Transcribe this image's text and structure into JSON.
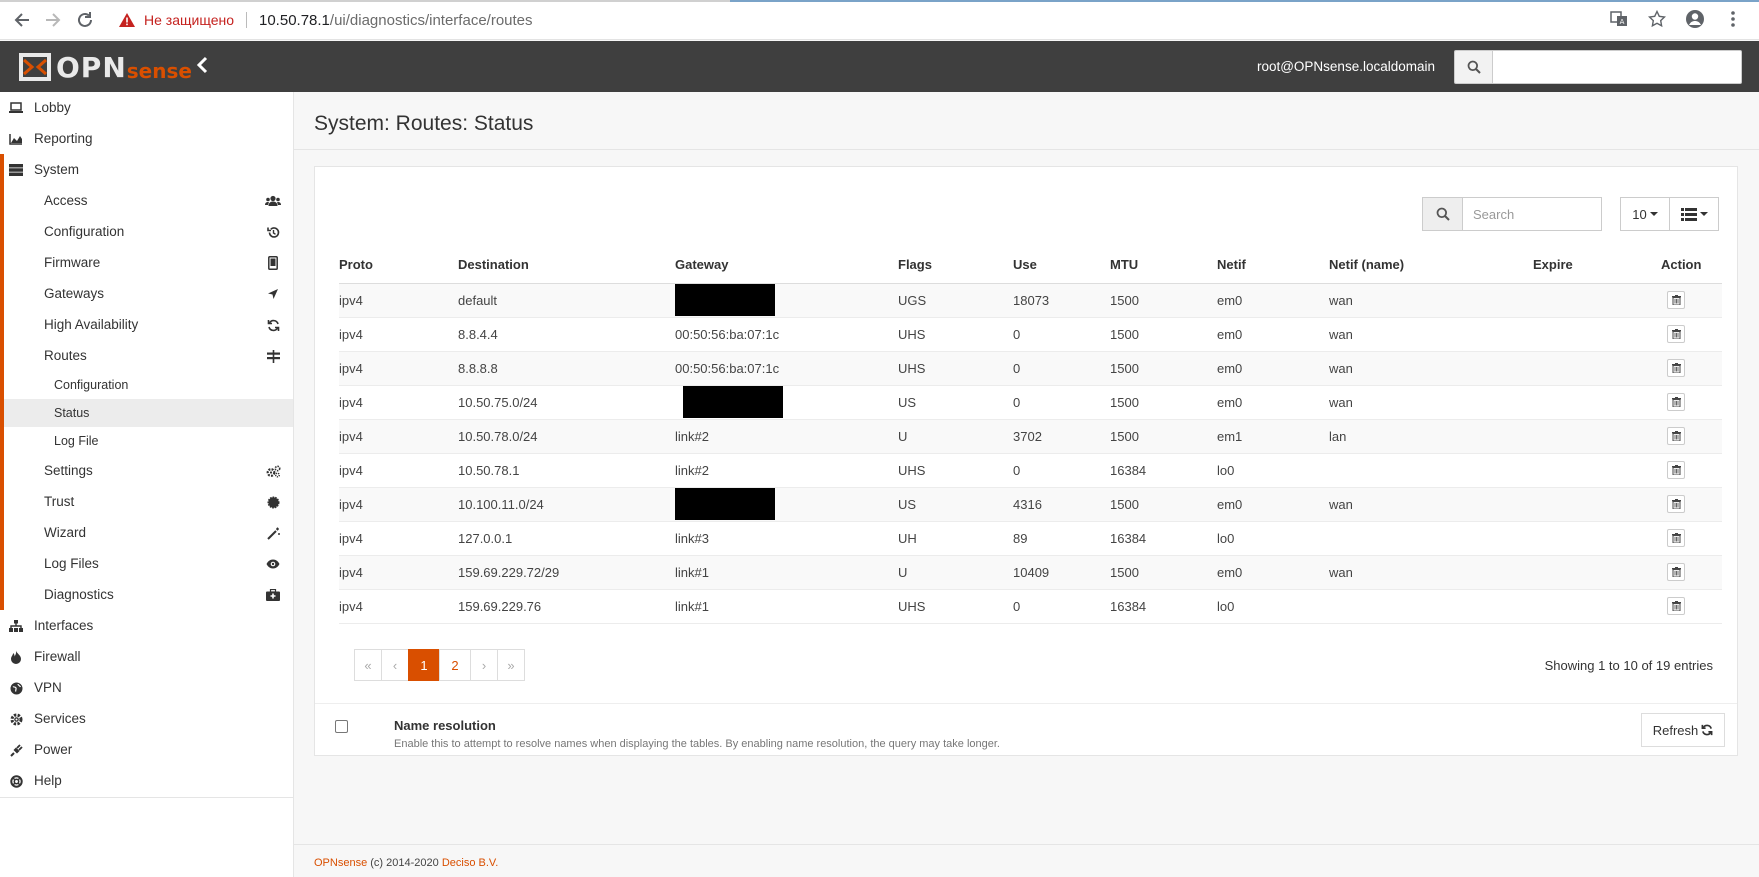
{
  "browser": {
    "not_secure": "Не защищено",
    "url_host": "10.50.78.1",
    "url_path": "/ui/diagnostics/interface/routes"
  },
  "topnav": {
    "logo_text": "OPN",
    "logo_sense": "sense",
    "user": "root@OPNsense.localdomain"
  },
  "sidebar": {
    "lobby": "Lobby",
    "reporting": "Reporting",
    "system": "System",
    "system_items": [
      {
        "label": "Access",
        "icon": "users-icon"
      },
      {
        "label": "Configuration",
        "icon": "history-icon"
      },
      {
        "label": "Firmware",
        "icon": "tablet-icon"
      },
      {
        "label": "Gateways",
        "icon": "location-arrow-icon"
      },
      {
        "label": "High Availability",
        "icon": "refresh-icon"
      },
      {
        "label": "Routes",
        "icon": "signpost-icon"
      }
    ],
    "routes_sub": [
      "Configuration",
      "Status",
      "Log File"
    ],
    "system_items_after": [
      {
        "label": "Settings",
        "icon": "cogs-icon"
      },
      {
        "label": "Trust",
        "icon": "certificate-icon"
      },
      {
        "label": "Wizard",
        "icon": "magic-icon"
      },
      {
        "label": "Log Files",
        "icon": "eye-icon"
      },
      {
        "label": "Diagnostics",
        "icon": "medkit-icon"
      }
    ],
    "bottom_items": [
      {
        "label": "Interfaces",
        "icon": "sitemap-icon"
      },
      {
        "label": "Firewall",
        "icon": "fire-icon"
      },
      {
        "label": "VPN",
        "icon": "globe-icon"
      },
      {
        "label": "Services",
        "icon": "cog-icon"
      },
      {
        "label": "Power",
        "icon": "plug-icon"
      },
      {
        "label": "Help",
        "icon": "life-ring-icon"
      }
    ]
  },
  "page": {
    "title": "System: Routes: Status"
  },
  "table": {
    "search_placeholder": "Search",
    "page_size": "10",
    "columns": [
      "Proto",
      "Destination",
      "Gateway",
      "Flags",
      "Use",
      "MTU",
      "Netif",
      "Netif (name)",
      "Expire",
      "Action"
    ],
    "rows": [
      {
        "proto": "ipv4",
        "destination": "default",
        "gateway": "",
        "redacted": true,
        "flags": "UGS",
        "use": "18073",
        "mtu": "1500",
        "netif": "em0",
        "netif_name": "wan",
        "expire": ""
      },
      {
        "proto": "ipv4",
        "destination": "8.8.4.4",
        "gateway": "00:50:56:ba:07:1c",
        "redacted": false,
        "flags": "UHS",
        "use": "0",
        "mtu": "1500",
        "netif": "em0",
        "netif_name": "wan",
        "expire": ""
      },
      {
        "proto": "ipv4",
        "destination": "8.8.8.8",
        "gateway": "00:50:56:ba:07:1c",
        "redacted": false,
        "flags": "UHS",
        "use": "0",
        "mtu": "1500",
        "netif": "em0",
        "netif_name": "wan",
        "expire": ""
      },
      {
        "proto": "ipv4",
        "destination": "10.50.75.0/24",
        "gateway": "",
        "redacted": true,
        "flags": "US",
        "use": "0",
        "mtu": "1500",
        "netif": "em0",
        "netif_name": "wan",
        "expire": ""
      },
      {
        "proto": "ipv4",
        "destination": "10.50.78.0/24",
        "gateway": "link#2",
        "redacted": false,
        "flags": "U",
        "use": "3702",
        "mtu": "1500",
        "netif": "em1",
        "netif_name": "lan",
        "expire": ""
      },
      {
        "proto": "ipv4",
        "destination": "10.50.78.1",
        "gateway": "link#2",
        "redacted": false,
        "flags": "UHS",
        "use": "0",
        "mtu": "16384",
        "netif": "lo0",
        "netif_name": "",
        "expire": ""
      },
      {
        "proto": "ipv4",
        "destination": "10.100.11.0/24",
        "gateway": "",
        "redacted": true,
        "flags": "US",
        "use": "4316",
        "mtu": "1500",
        "netif": "em0",
        "netif_name": "wan",
        "expire": ""
      },
      {
        "proto": "ipv4",
        "destination": "127.0.0.1",
        "gateway": "link#3",
        "redacted": false,
        "flags": "UH",
        "use": "89",
        "mtu": "16384",
        "netif": "lo0",
        "netif_name": "",
        "expire": ""
      },
      {
        "proto": "ipv4",
        "destination": "159.69.229.72/29",
        "gateway": "link#1",
        "redacted": false,
        "flags": "U",
        "use": "10409",
        "mtu": "1500",
        "netif": "em0",
        "netif_name": "wan",
        "expire": ""
      },
      {
        "proto": "ipv4",
        "destination": "159.69.229.76",
        "gateway": "link#1",
        "redacted": false,
        "flags": "UHS",
        "use": "0",
        "mtu": "16384",
        "netif": "lo0",
        "netif_name": "",
        "expire": ""
      }
    ],
    "pager": [
      "«",
      "‹",
      "1",
      "2",
      "›",
      "»"
    ],
    "pager_active": "1",
    "showing": "Showing 1 to 10 of 19 entries"
  },
  "options": {
    "name_resolution_title": "Name resolution",
    "name_resolution_desc": "Enable this to attempt to resolve names when displaying the tables. By enabling name resolution, the query may take longer.",
    "refresh_label": "Refresh"
  },
  "footer": {
    "brand": "OPNsense",
    "copy": " (c) 2014-2020 ",
    "company": "Deciso B.V."
  },
  "colors": {
    "accent": "#d94f00",
    "topnav": "#3f3f3f"
  }
}
